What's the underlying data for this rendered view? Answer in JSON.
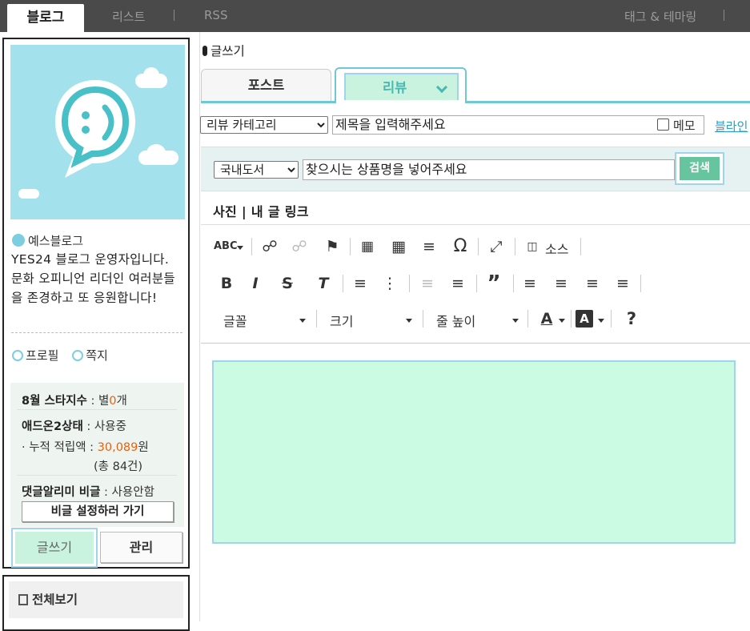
{
  "topnav": {
    "tab_blog": "블로그",
    "list": "리스트",
    "rss": "RSS",
    "tags_theme": "태그 & 테마링"
  },
  "sidebar": {
    "blog_name": "예스블로그",
    "description": "YES24 블로그 운영자입니다. 문화 오피니언 리더인 여러분들을 존경하고 또 응원합니다!",
    "profile_link": "프로필",
    "message_link": "쪽지",
    "stars_label": "8월 스타지수",
    "stars_prefix": "별",
    "stars_count": "0",
    "stars_suffix": "개",
    "addon_label": "애드온2상태",
    "addon_value": "사용중",
    "points_label": "누적 적립액 :",
    "points_value": "30,089",
    "points_unit": "원",
    "points_count": "(총 84건)",
    "comment_alarm_label": "댓글알리미 비글",
    "comment_alarm_value": "사용안함",
    "secret_button": "비글 설정하러 가기",
    "write_button": "글쓰기",
    "manage_button": "관리",
    "view_all": "전체보기"
  },
  "main": {
    "title": "글쓰기",
    "tab_post": "포스트",
    "tab_review": "리뷰",
    "category_select": "리뷰 카테고리",
    "title_placeholder": "제목을 입력해주세요",
    "memo_label": "메모",
    "blog_link": "블라인",
    "product_select": "국내도서",
    "product_placeholder": "찾으시는 상품명을 넣어주세요",
    "search_button": "검색",
    "ext_links": "사진 | 내 글 링크"
  },
  "toolbar": {
    "source_label": "소스",
    "font_label": "글꼴",
    "size_label": "크기",
    "line_height_label": "줄 높이",
    "help": "?"
  },
  "colors": {
    "accent_teal": "#6fc8d6",
    "mint": "#c9f3de",
    "search_green": "#66c59e",
    "highlight_orange": "#e8610c"
  }
}
